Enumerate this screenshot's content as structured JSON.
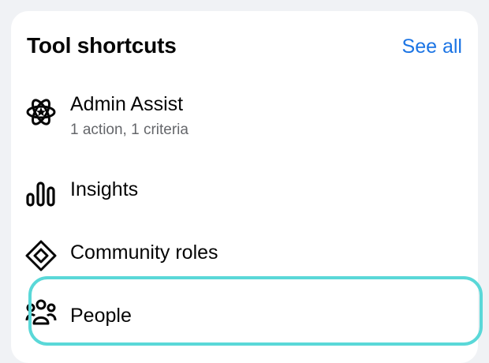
{
  "header": {
    "title": "Tool shortcuts",
    "see_all_label": "See all"
  },
  "items": [
    {
      "icon": "admin-assist-icon",
      "label": "Admin Assist",
      "sublabel": "1 action, 1 criteria"
    },
    {
      "icon": "insights-icon",
      "label": "Insights"
    },
    {
      "icon": "community-roles-icon",
      "label": "Community roles"
    },
    {
      "icon": "people-icon",
      "label": "People",
      "highlighted": true
    }
  ],
  "colors": {
    "accent": "#1b74e4",
    "highlight_border": "#5ad8d8",
    "background": "#f0f2f5"
  }
}
